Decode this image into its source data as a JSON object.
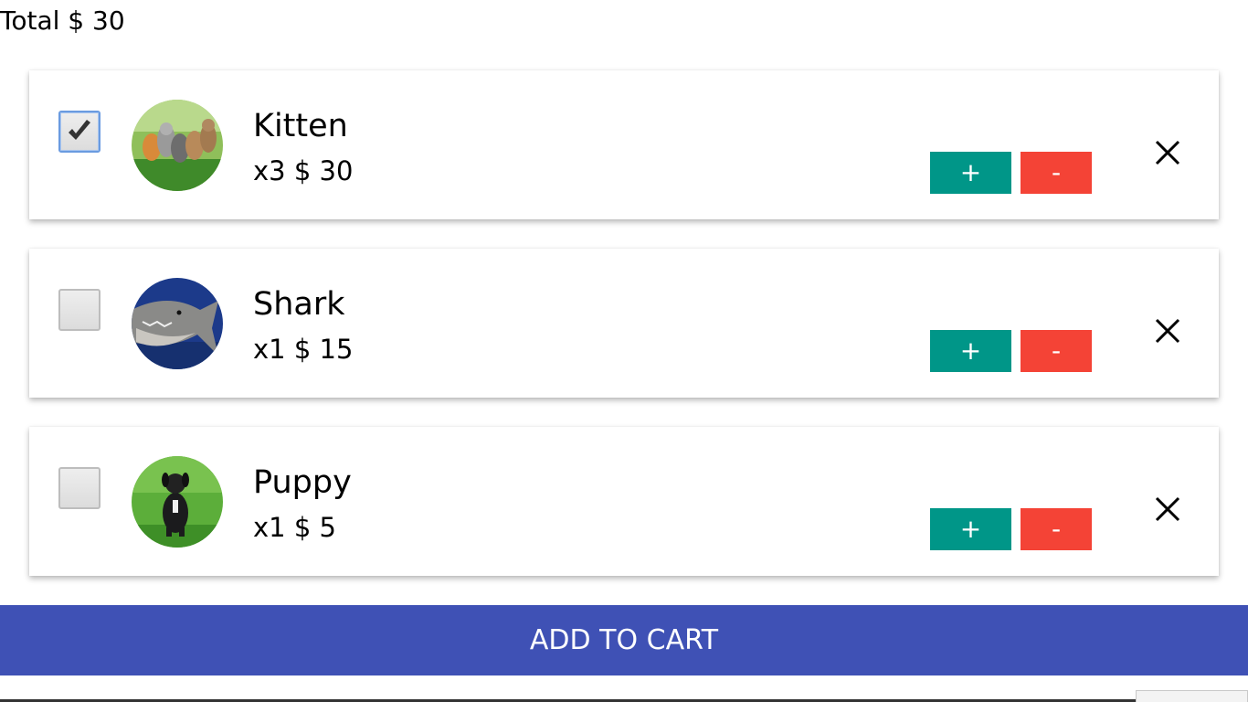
{
  "cart": {
    "total_label": "Total $ 30"
  },
  "items": [
    {
      "name": "Kitten",
      "qty_price": "x3 $ 30",
      "checked": true,
      "image": "kittens-photo",
      "plus_label": "+",
      "minus_label": "-"
    },
    {
      "name": "Shark",
      "qty_price": "x1 $ 15",
      "checked": false,
      "image": "shark-photo",
      "plus_label": "+",
      "minus_label": "-"
    },
    {
      "name": "Puppy",
      "qty_price": "x1 $ 5",
      "checked": false,
      "image": "puppy-photo",
      "plus_label": "+",
      "minus_label": "-"
    }
  ],
  "footer": {
    "add_to_cart_label": "ADD TO CART"
  },
  "colors": {
    "plus_button": "#009688",
    "minus_button": "#f44336",
    "add_to_cart": "#3f51b5"
  }
}
